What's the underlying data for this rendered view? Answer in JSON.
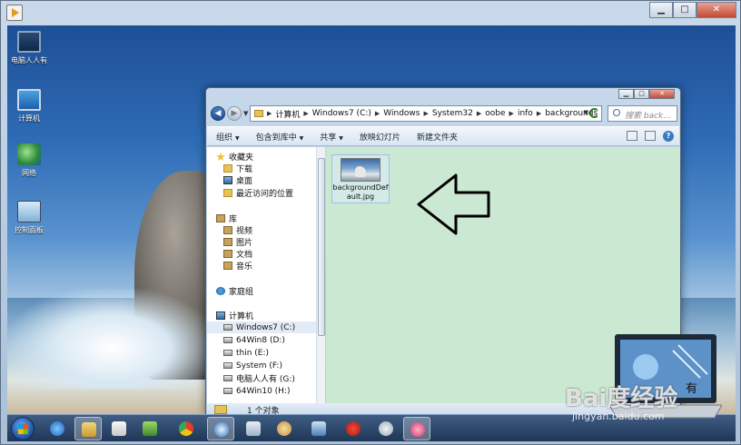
{
  "vm": {
    "controls": {
      "minimize": "▁",
      "maximize": "□",
      "close": "✕"
    }
  },
  "desktop": {
    "icons": [
      {
        "label": "电脑人人有",
        "icon": "laptop-icon"
      },
      {
        "label": "计算机",
        "icon": "computer-icon"
      },
      {
        "label": "网络",
        "icon": "network-icon"
      },
      {
        "label": "控制面板",
        "icon": "control-panel-icon"
      }
    ]
  },
  "explorer": {
    "controls": {
      "minimize": "▁",
      "maximize": "□",
      "close": "✕"
    },
    "breadcrumb": [
      "计算机",
      "Windows7 (C:)",
      "Windows",
      "System32",
      "oobe",
      "info",
      "backgrounds"
    ],
    "search_placeholder": "搜索 back...",
    "toolbar": {
      "organize": "组织",
      "include_library": "包含到库中",
      "share": "共享",
      "slideshow": "放映幻灯片",
      "new_folder": "新建文件夹"
    },
    "nav": {
      "favorites": "收藏夹",
      "downloads": "下载",
      "desktop": "桌面",
      "recent": "最近访问的位置",
      "libraries": "库",
      "videos": "视频",
      "pictures": "图片",
      "documents": "文档",
      "music": "音乐",
      "homegroup": "家庭组",
      "computer": "计算机",
      "drives": [
        "Windows7 (C:)",
        "64Win8  (D:)",
        "thin (E:)",
        "System (F:)",
        "电脑人人有 (G:)",
        "64Win10 (H:)"
      ]
    },
    "file": {
      "name": "backgroundDefault.jpg"
    },
    "status": "1 个对象"
  },
  "watermark": {
    "brand": "Bai度经验",
    "url": "jingyan.baidu.com",
    "logo_text": "有"
  },
  "colors": {
    "content_bg": "#cae8d2",
    "taskbar": "#2b4568",
    "arrow": "#000000"
  }
}
